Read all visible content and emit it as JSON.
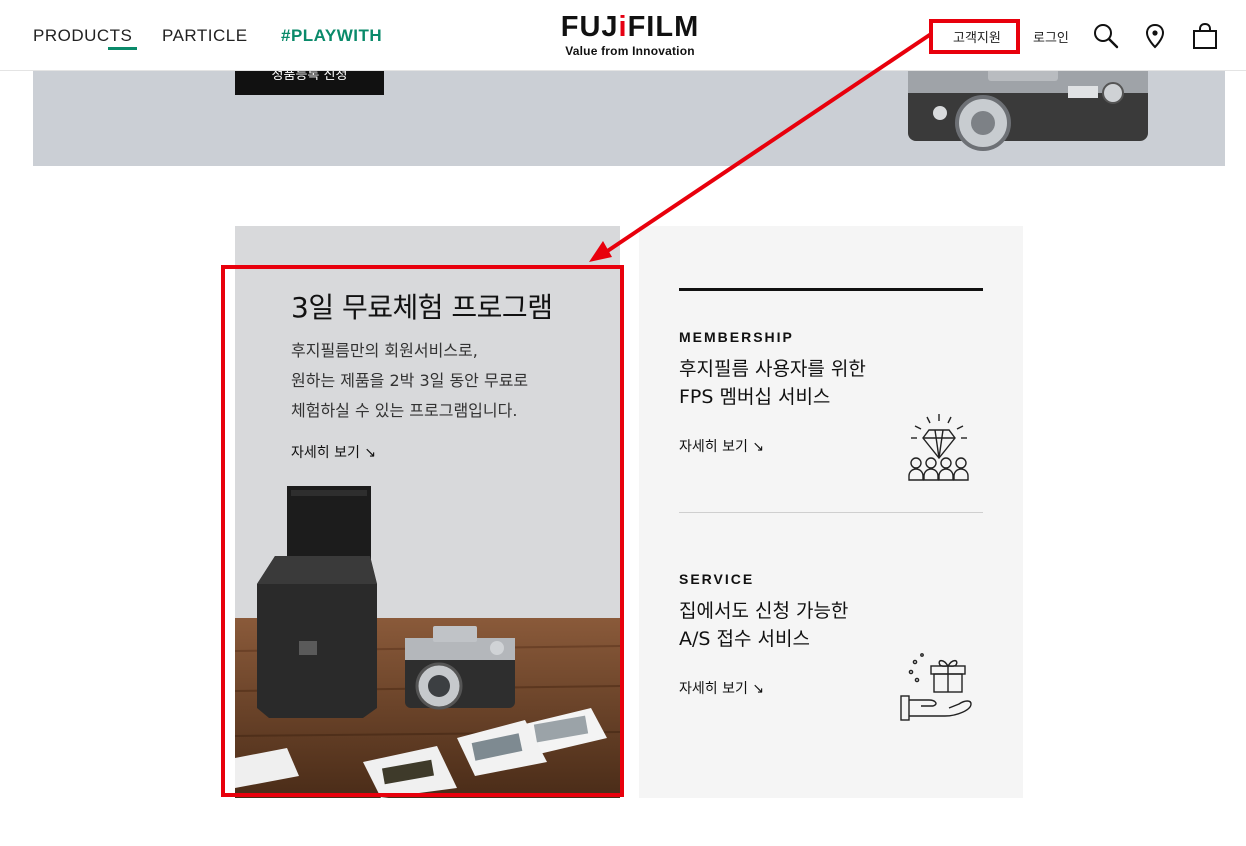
{
  "header": {
    "nav": [
      {
        "label": "PRODUCTS"
      },
      {
        "label": "PARTICLE"
      },
      {
        "label": "#PLAYWITH"
      }
    ],
    "logo": {
      "word": "FUJIFILM",
      "tagline": "Value from Innovation"
    },
    "support_label": "고객지원",
    "login_label": "로그인",
    "icons": [
      "search-icon",
      "location-pin-icon",
      "shopping-bag-icon"
    ]
  },
  "hero": {
    "button_label": "정품등록 신청"
  },
  "promo": {
    "title": "3일 무료체험 프로그램",
    "desc_lines": [
      "후지필름만의 회원서비스로,",
      "원하는 제품을 2박 3일 동안 무료로",
      "체험하실 수 있는 프로그램입니다."
    ],
    "more_label": "자세히 보기 ↘"
  },
  "membership": {
    "label": "MEMBERSHIP",
    "title_lines": [
      "후지필름 사용자를 위한",
      "FPS 멤버십 서비스"
    ],
    "more_label": "자세히 보기 ↘",
    "icon": "diamond-people-icon"
  },
  "service": {
    "label": "SERVICE",
    "title_lines": [
      "집에서도 신청 가능한",
      "A/S 접수 서비스"
    ],
    "more_label": "자세히 보기 ↘",
    "icon": "gift-hand-icon"
  },
  "colors": {
    "accent_green": "#0a8a6a",
    "annotation_red": "#e8000c",
    "promo_bg": "#d8d9db",
    "side_bg": "#f5f5f5"
  }
}
